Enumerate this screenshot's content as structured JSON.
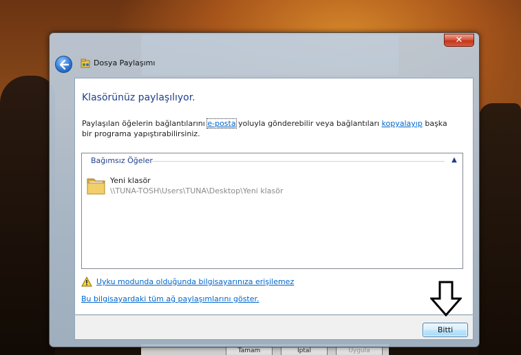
{
  "window": {
    "title": "Dosya Paylaşımı",
    "close_label": "✕"
  },
  "content": {
    "heading": "Klasörünüz paylaşılıyor.",
    "desc_part1": "Paylaşılan öğelerin bağlantılarını ",
    "email_link": "e-posta",
    "desc_part2": " yoluyla gönderebilir veya bağlantıları ",
    "copy_link": "kopyalayıp",
    "desc_part3": " başka bir programa yapıştırabilirsiniz."
  },
  "items": {
    "group_header": "Bağımsız Öğeler",
    "list": [
      {
        "name": "Yeni klasör",
        "path": "\\\\TUNA-TOSH\\Users\\TUNA\\Desktop\\Yeni klasör"
      }
    ]
  },
  "links": {
    "sleep_warning": "Uyku modunda olduğunda bilgisayarınıza erişilemez",
    "show_all_shares": "Bu bilgisayardaki tüm ağ paylaşımlarını göster."
  },
  "footer": {
    "finish_label": "Bitti"
  },
  "background_dialog": {
    "buttons": [
      "Tamam",
      "İptal",
      "Uygula"
    ]
  },
  "icons": {
    "back": "back-arrow-icon",
    "title": "sharing-icon",
    "folder": "folder-icon",
    "warning": "warning-icon",
    "annotation": "down-arrow-icon"
  },
  "colors": {
    "heading": "#1e3f8a",
    "link": "#0066cc",
    "close": "#c2361d"
  }
}
